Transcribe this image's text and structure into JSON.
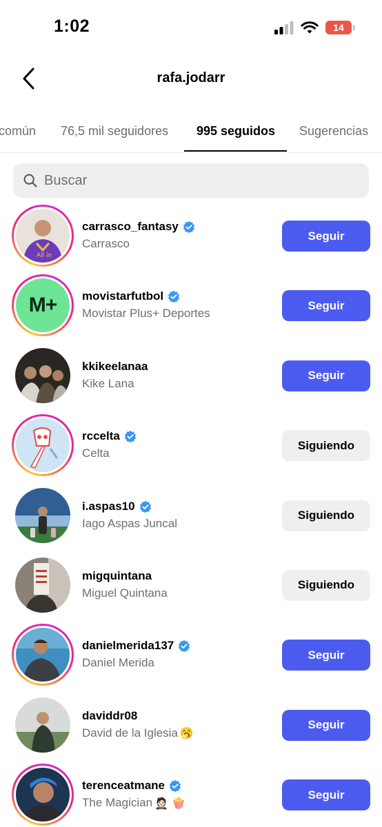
{
  "status_bar": {
    "time": "1:02",
    "battery": "14"
  },
  "header": {
    "title": "rafa.jodarr",
    "back_icon": "chevron-left-icon"
  },
  "tabs": [
    {
      "label": "común"
    },
    {
      "label": "76,5 mil seguidores"
    },
    {
      "label": "995 seguidos",
      "active": true
    },
    {
      "label": "Sugerencias"
    }
  ],
  "search": {
    "placeholder": "Buscar",
    "value": ""
  },
  "users": [
    {
      "username": "carrasco_fantasy",
      "name": "Carrasco",
      "verified": true,
      "story": true,
      "button": "Seguir",
      "state": "follow"
    },
    {
      "username": "movistarfutbol",
      "name": "Movistar Plus+ Deportes",
      "verified": true,
      "story": true,
      "button": "Seguir",
      "state": "follow",
      "avatar_text": "M+"
    },
    {
      "username": "kkikeelanaa",
      "name": "Kike Lana",
      "verified": false,
      "story": false,
      "button": "Seguir",
      "state": "follow"
    },
    {
      "username": "rccelta",
      "name": "Celta",
      "verified": true,
      "story": true,
      "button": "Siguiendo",
      "state": "following"
    },
    {
      "username": "i.aspas10",
      "name": "Iago Aspas Juncal",
      "verified": true,
      "story": false,
      "button": "Siguiendo",
      "state": "following"
    },
    {
      "username": "migquintana",
      "name": "Miguel Quintana",
      "verified": false,
      "story": false,
      "button": "Siguiendo",
      "state": "following"
    },
    {
      "username": "danielmerida137",
      "name": "Daniel Merida",
      "verified": true,
      "story": true,
      "button": "Seguir",
      "state": "follow"
    },
    {
      "username": "daviddr08",
      "name": "David de la Iglesia",
      "name_emoji": "🥱",
      "verified": false,
      "story": false,
      "button": "Seguir",
      "state": "follow"
    },
    {
      "username": "terenceatmane",
      "name": "The Magician",
      "name_emoji": "🤵🏻 🍿",
      "verified": true,
      "story": true,
      "button": "Seguir",
      "state": "follow"
    }
  ],
  "colors": {
    "follow_button": "#4c5bef",
    "following_button": "#efeff1",
    "verified": "#3897f0"
  }
}
